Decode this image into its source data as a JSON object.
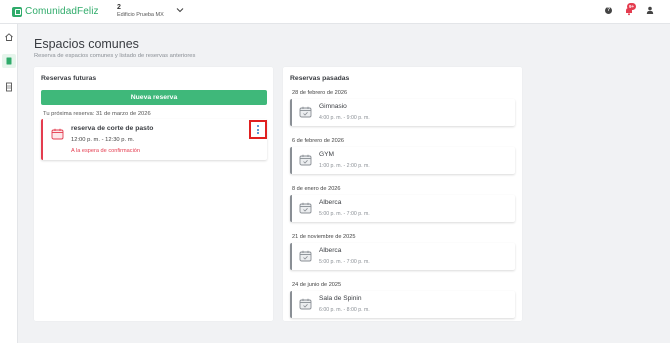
{
  "app": {
    "name": "ComunidadFeliz"
  },
  "building": {
    "number": "2",
    "name": "Edificio Prueba MX"
  },
  "header": {
    "help_label": "?",
    "notifications_badge": "9+"
  },
  "page": {
    "title": "Espacios comunes",
    "subtitle": "Reserva de espacios comunes y listado de reservas anteriores"
  },
  "future": {
    "title": "Reservas futuras",
    "new_button": "Nueva reserva",
    "next_label": "Tu próxima reserva: 31 de marzo de 2026",
    "reservation": {
      "title": "reserva de corte de pasto",
      "time": "12:00 p. m. - 12:30 p. m.",
      "status": "A la espera de confirmación"
    }
  },
  "past": {
    "title": "Reservas pasadas",
    "items": [
      {
        "date": "28 de febrero de 2026",
        "name": "Gimnasio",
        "time": "4:00 p. m. - 9:00 p. m."
      },
      {
        "date": "6 de febrero de 2026",
        "name": "GYM",
        "time": "1:00 p. m. - 2:00 p. m."
      },
      {
        "date": "8 de enero de 2026",
        "name": "Alberca",
        "time": "5:00 p. m. - 7:00 p. m."
      },
      {
        "date": "21 de noviembre de 2025",
        "name": "Alberca",
        "time": "5:00 p. m. - 7:00 p. m."
      },
      {
        "date": "24 de junio de 2025",
        "name": "Sala de Spinin",
        "time": "6:00 p. m. - 8:00 p. m."
      }
    ]
  },
  "icons": {
    "logo": "logo-icon",
    "chevron": "chevron-down-icon",
    "help": "help-icon",
    "bell": "bell-icon",
    "user": "user-icon",
    "home": "home-icon",
    "spaces": "common-spaces-icon",
    "building": "building-icon",
    "calendar": "calendar-icon",
    "kebab": "more-options-icon"
  },
  "colors": {
    "brand": "#2fab6a",
    "button": "#3fb87a",
    "danger": "#e43c4f",
    "highlight": "#e02020",
    "muted": "#8a8f95"
  }
}
